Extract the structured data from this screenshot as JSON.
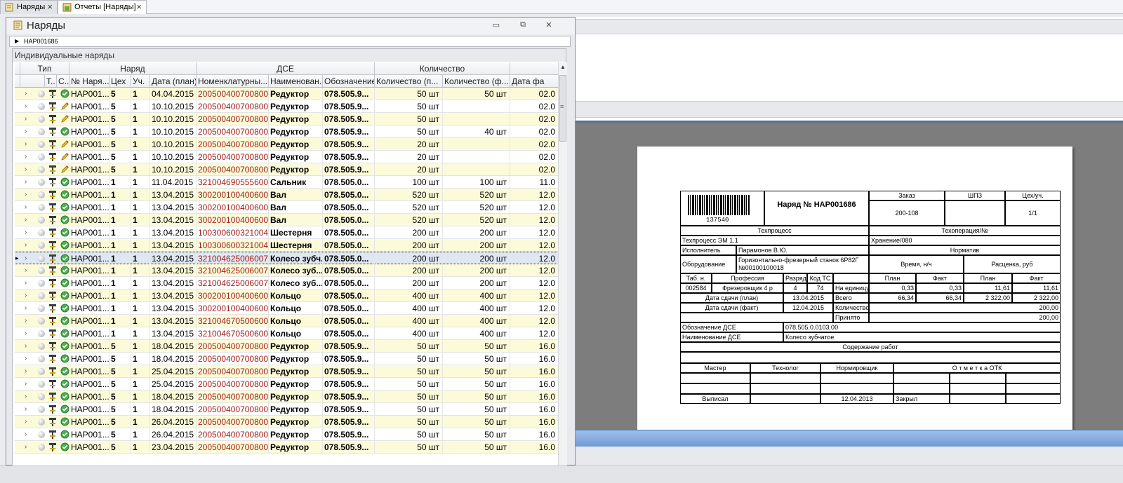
{
  "tabs": [
    {
      "label": "Наряды",
      "icon": "scroll-icon"
    },
    {
      "label": "Отчеты [Наряды]",
      "icon": "report-icon"
    }
  ],
  "window": {
    "title": "Наряды",
    "breadcrumb": "НАР001686",
    "panel_title": "Индивидуальные наряды"
  },
  "grid": {
    "bands": [
      "Тип",
      "Наряд",
      "ДСЕ",
      "Количество"
    ],
    "columns": [
      "Т..",
      "С..",
      "№ Наря...",
      "Цех",
      "Уч.",
      "Дата (план)",
      "Номенклатурны...",
      "Наименован...",
      "Обозначение",
      "Количество (п...",
      "Количество (ф...",
      "Дата фа"
    ],
    "rows": [
      {
        "status": "ok",
        "num": "НАР001...",
        "shop": "5",
        "sec": "1",
        "date": "04.04.2015",
        "nom": "200500400700800...",
        "name": "Редуктор",
        "desig": "078.505.9...",
        "qplan": "50 шт",
        "qfact": "50 шт",
        "dfact": "02.0"
      },
      {
        "status": "edit",
        "num": "НАР001...",
        "shop": "5",
        "sec": "1",
        "date": "10.10.2015",
        "nom": "200500400700800...",
        "name": "Редуктор",
        "desig": "078.505.9...",
        "qplan": "50 шт",
        "qfact": "",
        "dfact": "02.0"
      },
      {
        "status": "edit",
        "num": "НАР001...",
        "shop": "5",
        "sec": "1",
        "date": "10.10.2015",
        "nom": "200500400700800...",
        "name": "Редуктор",
        "desig": "078.505.9...",
        "qplan": "50 шт",
        "qfact": "",
        "dfact": "02.0"
      },
      {
        "status": "ok",
        "num": "НАР001...",
        "shop": "5",
        "sec": "1",
        "date": "10.10.2015",
        "nom": "200500400700800...",
        "name": "Редуктор",
        "desig": "078.505.9...",
        "qplan": "50 шт",
        "qfact": "40 шт",
        "dfact": "02.0"
      },
      {
        "status": "edit",
        "num": "НАР001...",
        "shop": "5",
        "sec": "1",
        "date": "10.10.2015",
        "nom": "200500400700800...",
        "name": "Редуктор",
        "desig": "078.505.9...",
        "qplan": "20 шт",
        "qfact": "",
        "dfact": "02.0"
      },
      {
        "status": "edit",
        "num": "НАР001...",
        "shop": "5",
        "sec": "1",
        "date": "10.10.2015",
        "nom": "200500400700800...",
        "name": "Редуктор",
        "desig": "078.505.9...",
        "qplan": "20 шт",
        "qfact": "",
        "dfact": "02.0"
      },
      {
        "status": "edit",
        "num": "НАР001...",
        "shop": "5",
        "sec": "1",
        "date": "10.10.2015",
        "nom": "200500400700800...",
        "name": "Редуктор",
        "desig": "078.505.9...",
        "qplan": "20 шт",
        "qfact": "",
        "dfact": "02.0"
      },
      {
        "status": "ok",
        "num": "НАР001...",
        "shop": "1",
        "sec": "1",
        "date": "11.04.2015",
        "nom": "321004690555600...",
        "name": "Сальник",
        "desig": "078.505.0...",
        "qplan": "100 шт",
        "qfact": "100 шт",
        "dfact": "11.0"
      },
      {
        "status": "ok",
        "num": "НАР001...",
        "shop": "1",
        "sec": "1",
        "date": "13.04.2015",
        "nom": "300200100400600...",
        "name": "Вал",
        "desig": "078.505.0...",
        "qplan": "520 шт",
        "qfact": "520 шт",
        "dfact": "12.0"
      },
      {
        "status": "ok",
        "num": "НАР001...",
        "shop": "1",
        "sec": "1",
        "date": "13.04.2015",
        "nom": "300200100400600...",
        "name": "Вал",
        "desig": "078.505.0...",
        "qplan": "520 шт",
        "qfact": "520 шт",
        "dfact": "12.0"
      },
      {
        "status": "ok",
        "num": "НАР001...",
        "shop": "1",
        "sec": "1",
        "date": "13.04.2015",
        "nom": "300200100400600...",
        "name": "Вал",
        "desig": "078.505.0...",
        "qplan": "520 шт",
        "qfact": "520 шт",
        "dfact": "12.0"
      },
      {
        "status": "ok",
        "num": "НАР001...",
        "shop": "1",
        "sec": "1",
        "date": "13.04.2015",
        "nom": "10030060032100461",
        "name": "Шестерня",
        "desig": "078.505.0...",
        "qplan": "200 шт",
        "qfact": "200 шт",
        "dfact": "12.0"
      },
      {
        "status": "ok",
        "num": "НАР001...",
        "shop": "1",
        "sec": "1",
        "date": "13.04.2015",
        "nom": "10030060032100461",
        "name": "Шестерня",
        "desig": "078.505.0...",
        "qplan": "200 шт",
        "qfact": "200 шт",
        "dfact": "12.0"
      },
      {
        "status": "ok",
        "num": "НАР001...",
        "shop": "1",
        "sec": "1",
        "date": "13.04.2015",
        "nom": "321004625006007...",
        "name": "Колесо зубч...",
        "desig": "078.505.0...",
        "qplan": "200 шт",
        "qfact": "200 шт",
        "dfact": "12.0",
        "selected": true
      },
      {
        "status": "ok",
        "num": "НАР001...",
        "shop": "1",
        "sec": "1",
        "date": "13.04.2015",
        "nom": "321004625006007...",
        "name": "Колесо зуб...",
        "desig": "078.505.0...",
        "qplan": "200 шт",
        "qfact": "200 шт",
        "dfact": "12.0"
      },
      {
        "status": "ok",
        "num": "НАР001...",
        "shop": "1",
        "sec": "1",
        "date": "13.04.2015",
        "nom": "321004625006007...",
        "name": "Колесо зуб...",
        "desig": "078.505.0...",
        "qplan": "200 шт",
        "qfact": "200 шт",
        "dfact": "12.0"
      },
      {
        "status": "ok",
        "num": "НАР001...",
        "shop": "1",
        "sec": "1",
        "date": "13.04.2015",
        "nom": "300200100400600...",
        "name": "Кольцо",
        "desig": "078.505.0...",
        "qplan": "400 шт",
        "qfact": "400 шт",
        "dfact": "12.0"
      },
      {
        "status": "ok",
        "num": "НАР001...",
        "shop": "1",
        "sec": "1",
        "date": "13.04.2015",
        "nom": "300200100400600...",
        "name": "Кольцо",
        "desig": "078.505.0...",
        "qplan": "400 шт",
        "qfact": "400 шт",
        "dfact": "12.0"
      },
      {
        "status": "ok",
        "num": "НАР001...",
        "shop": "1",
        "sec": "1",
        "date": "13.04.2015",
        "nom": "321004670500600...",
        "name": "Кольцо",
        "desig": "078.505.0...",
        "qplan": "400 шт",
        "qfact": "400 шт",
        "dfact": "12.0"
      },
      {
        "status": "ok",
        "num": "НАР001...",
        "shop": "1",
        "sec": "1",
        "date": "13.04.2015",
        "nom": "321004670500600...",
        "name": "Кольцо",
        "desig": "078.505.0...",
        "qplan": "400 шт",
        "qfact": "400 шт",
        "dfact": "12.0"
      },
      {
        "status": "ok",
        "num": "НАР001...",
        "shop": "5",
        "sec": "1",
        "date": "18.04.2015",
        "nom": "200500400700800...",
        "name": "Редуктор",
        "desig": "078.505.9...",
        "qplan": "50 шт",
        "qfact": "50 шт",
        "dfact": "16.0"
      },
      {
        "status": "ok",
        "num": "НАР001...",
        "shop": "5",
        "sec": "1",
        "date": "18.04.2015",
        "nom": "200500400700800...",
        "name": "Редуктор",
        "desig": "078.505.9...",
        "qplan": "50 шт",
        "qfact": "50 шт",
        "dfact": "16.0"
      },
      {
        "status": "ok",
        "num": "НАР001...",
        "shop": "5",
        "sec": "1",
        "date": "25.04.2015",
        "nom": "200500400700800...",
        "name": "Редуктор",
        "desig": "078.505.9...",
        "qplan": "50 шт",
        "qfact": "50 шт",
        "dfact": "16.0"
      },
      {
        "status": "ok",
        "num": "НАР001...",
        "shop": "5",
        "sec": "1",
        "date": "25.04.2015",
        "nom": "200500400700800...",
        "name": "Редуктор",
        "desig": "078.505.9...",
        "qplan": "50 шт",
        "qfact": "50 шт",
        "dfact": "16.0"
      },
      {
        "status": "ok",
        "num": "НАР001...",
        "shop": "5",
        "sec": "1",
        "date": "18.04.2015",
        "nom": "200500400700800...",
        "name": "Редуктор",
        "desig": "078.505.9...",
        "qplan": "50 шт",
        "qfact": "50 шт",
        "dfact": "16.0"
      },
      {
        "status": "ok",
        "num": "НАР001...",
        "shop": "5",
        "sec": "1",
        "date": "18.04.2015",
        "nom": "200500400700800...",
        "name": "Редуктор",
        "desig": "078.505.9...",
        "qplan": "50 шт",
        "qfact": "50 шт",
        "dfact": "16.0"
      },
      {
        "status": "ok",
        "num": "НАР001...",
        "shop": "5",
        "sec": "1",
        "date": "26.04.2015",
        "nom": "200500400700800...",
        "name": "Редуктор",
        "desig": "078.505.9...",
        "qplan": "50 шт",
        "qfact": "50 шт",
        "dfact": "16.0"
      },
      {
        "status": "ok",
        "num": "НАР001...",
        "shop": "5",
        "sec": "1",
        "date": "26.04.2015",
        "nom": "200500400700800...",
        "name": "Редуктор",
        "desig": "078.505.9...",
        "qplan": "50 шт",
        "qfact": "50 шт",
        "dfact": "16.0"
      },
      {
        "status": "ok",
        "num": "НАР001...",
        "shop": "5",
        "sec": "1",
        "date": "23.04.2015",
        "nom": "200500400700800...",
        "name": "Редуктор",
        "desig": "078.505.9...",
        "qplan": "50 шт",
        "qfact": "50 шт",
        "dfact": "16.0"
      }
    ]
  },
  "report": {
    "barcode": "137540",
    "title": "Наряд № НАР001686",
    "order_h": "Заказ",
    "order_v": "200-108",
    "shpz_h": "ШПЗ",
    "shpz_v": "",
    "shop_h": "Цех/уч.",
    "shop_v": "1/1",
    "techproc_h": "Техпроцесс",
    "techproc_v": "Техпроцесс ЭМ 1.1",
    "techop_h": "Техоперация/№",
    "techop_v": "Хранение/080",
    "executor_h": "Исполнитель",
    "executor_v": "Парамонов В.Ю.",
    "norm_h": "Норматив",
    "equip_h": "Оборудование",
    "equip_v1": "Горизонтально-фрезерный станок 6Р82Г",
    "equip_v2": "№00100100018",
    "time_h": "Время, н/ч",
    "rate_h": "Расценка, руб",
    "tab_h": "Таб. н.",
    "prof_h": "Профессия",
    "grade_h": "Разряд",
    "code_h": "Код ТС",
    "plan_h": "План",
    "fact_h": "Факт",
    "plan2_h": "План",
    "fact2_h": "Факт",
    "tab_v": "002584",
    "prof_v": "Фрезеровщик 4 р",
    "grade_v": "4",
    "code_v": "74",
    "perunit_h": "На единицу",
    "pu_plan": "0,33",
    "pu_fact": "0,33",
    "pu_plan2": "11,61",
    "pu_fact2": "11,61",
    "dplan_h": "Дата сдачи (план)",
    "dplan_v": "13.04.2015",
    "total_h": "Всего",
    "t_plan": "66,34",
    "t_fact": "66,34",
    "t_plan2": "2 322,00",
    "t_fact2": "2 322,00",
    "dfact_h": "Дата сдачи (факт)",
    "dfact_v": "12.04.2015",
    "qty_h": "Количество",
    "qty_v": "200,00",
    "acc_h": "Принято",
    "acc_v": "200,00",
    "dse_h": "Обозначение ДСЕ",
    "dse_v": "078.505.0.0103.00",
    "dsename_h": "Наименование ДСЕ",
    "dsename_v": "Колесо зубчатое",
    "content_h": "Содержание работ",
    "master_h": "Мастер",
    "tech_h": "Технолог",
    "normer_h": "Нормировщик",
    "otk_h": "О т м е т к а   ОТК",
    "issued_h": "Выписал",
    "issued_v": "12.04.2013",
    "closed_h": "Закрыл"
  }
}
